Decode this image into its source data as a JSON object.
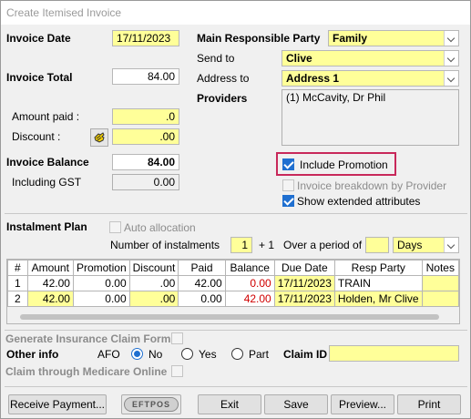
{
  "window": {
    "title": "Create Itemised Invoice"
  },
  "invoice": {
    "date_label": "Invoice Date",
    "date_value": "17/11/2023",
    "total_label": "Invoice Total",
    "total_value": "84.00",
    "amount_paid_label": "Amount paid :",
    "amount_paid_value": ".0",
    "discount_label": "Discount :",
    "discount_value": ".00",
    "balance_label": "Invoice Balance",
    "balance_value": "84.00",
    "gst_label": "Including GST",
    "gst_value": "0.00"
  },
  "party": {
    "main_label": "Main Responsible Party",
    "main_value": "Family",
    "send_to_label": "Send to",
    "send_to_value": "Clive",
    "address_label": "Address to",
    "address_value": "Address 1",
    "providers_label": "Providers",
    "providers_value": "(1) McCavity, Dr Phil"
  },
  "options": {
    "include_promotion": "Include Promotion",
    "invoice_breakdown": "Invoice breakdown by Provider",
    "show_extended": "Show extended attributes"
  },
  "instalment": {
    "plan_label": "Instalment Plan",
    "auto_allocation": "Auto allocation",
    "number_label": "Number of instalments",
    "number_value": "1",
    "plus": "+ 1",
    "period_label": "Over a period of",
    "period_value": "",
    "period_unit": "Days"
  },
  "table": {
    "headers": [
      "#",
      "Amount",
      "Promotion",
      "Discount",
      "Paid",
      "Balance",
      "Due Date",
      "Resp Party",
      "Notes"
    ],
    "rows": [
      [
        "1",
        "42.00",
        "0.00",
        ".00",
        "42.00",
        "0.00",
        "17/11/2023",
        "TRAIN",
        ""
      ],
      [
        "2",
        "42.00",
        "0.00",
        ".00",
        "0.00",
        "42.00",
        "17/11/2023",
        "Holden, Mr Clive",
        ""
      ]
    ]
  },
  "bottom": {
    "insurance_label": "Generate Insurance Claim Form",
    "other_info_label": "Other info",
    "afo_label": "AFO",
    "no_label": "No",
    "yes_label": "Yes",
    "part_label": "Part",
    "claim_id_label": "Claim ID",
    "claim_id_value": "",
    "medicare_label": "Claim through Medicare Online"
  },
  "buttons": {
    "receive_payment": "Receive Payment...",
    "eftpos": "EFTPOS",
    "exit": "Exit",
    "save": "Save",
    "preview": "Preview...",
    "print": "Print"
  },
  "colors": {
    "field_yellow": "#ffff99",
    "highlight": "#c8285a",
    "accent": "#1f6fd0",
    "negative": "#d00000"
  }
}
